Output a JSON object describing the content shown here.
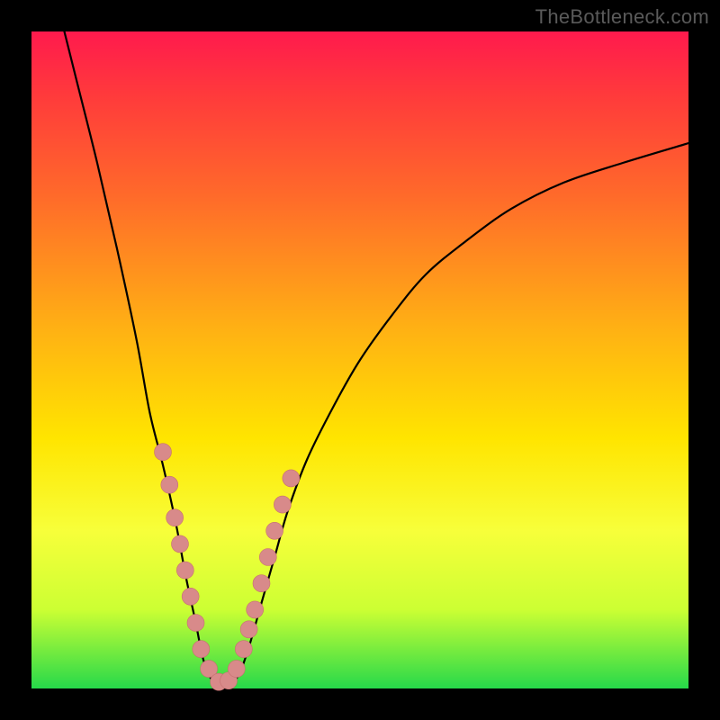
{
  "watermark": "TheBottleneck.com",
  "chart_data": {
    "type": "line",
    "title": "",
    "xlabel": "",
    "ylabel": "",
    "xlim": [
      0,
      100
    ],
    "ylim": [
      0,
      100
    ],
    "grid": false,
    "legend": false,
    "series": [
      {
        "name": "curve",
        "points": [
          [
            5,
            100
          ],
          [
            7,
            92
          ],
          [
            10,
            80
          ],
          [
            13,
            67
          ],
          [
            16,
            53
          ],
          [
            18,
            42
          ],
          [
            20,
            34
          ],
          [
            22,
            25
          ],
          [
            23.5,
            17
          ],
          [
            25,
            10
          ],
          [
            26,
            5
          ],
          [
            27,
            2
          ],
          [
            28.5,
            0.5
          ],
          [
            30,
            0.5
          ],
          [
            31.5,
            2
          ],
          [
            33,
            6
          ],
          [
            35,
            13
          ],
          [
            37,
            20
          ],
          [
            39,
            27
          ],
          [
            42,
            35
          ],
          [
            46,
            43
          ],
          [
            50,
            50
          ],
          [
            55,
            57
          ],
          [
            60,
            63
          ],
          [
            66,
            68
          ],
          [
            73,
            73
          ],
          [
            81,
            77
          ],
          [
            90,
            80
          ],
          [
            100,
            83
          ]
        ]
      },
      {
        "name": "markers",
        "points": [
          [
            20,
            36
          ],
          [
            21,
            31
          ],
          [
            21.8,
            26
          ],
          [
            22.6,
            22
          ],
          [
            23.4,
            18
          ],
          [
            24.2,
            14
          ],
          [
            25,
            10
          ],
          [
            25.8,
            6
          ],
          [
            27,
            3
          ],
          [
            28.5,
            1
          ],
          [
            30,
            1.2
          ],
          [
            31.2,
            3
          ],
          [
            32.3,
            6
          ],
          [
            33.1,
            9
          ],
          [
            34,
            12
          ],
          [
            35,
            16
          ],
          [
            36,
            20
          ],
          [
            37,
            24
          ],
          [
            38.2,
            28
          ],
          [
            39.5,
            32
          ]
        ]
      }
    ]
  }
}
